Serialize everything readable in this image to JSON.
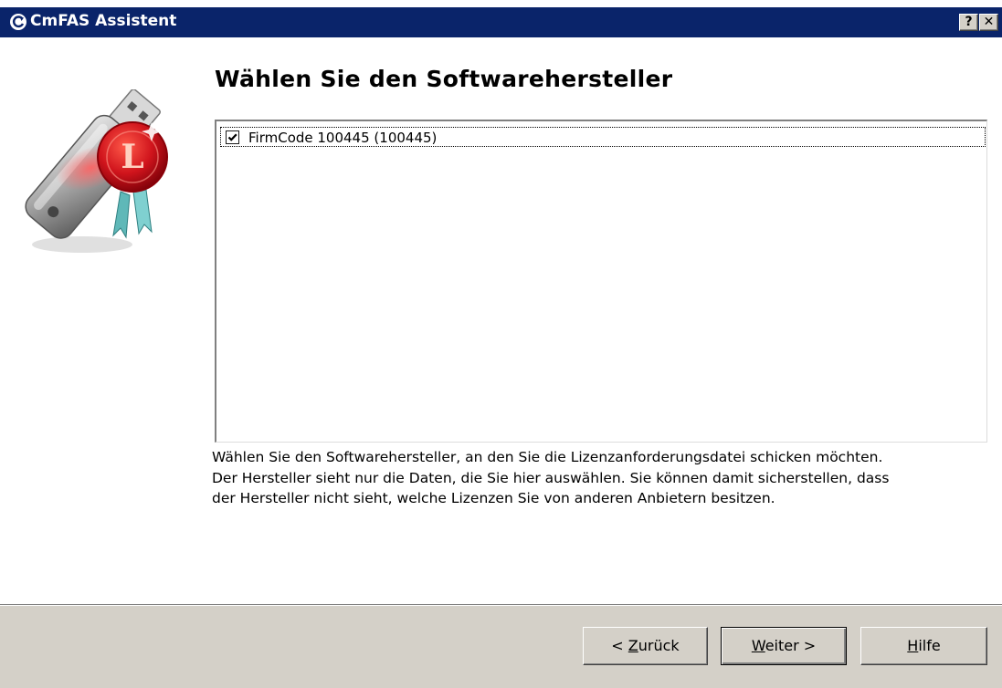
{
  "window": {
    "title": "CmFAS Assistent",
    "help_button": "?",
    "close_button": "✕"
  },
  "page": {
    "heading": "Wählen Sie den Softwarehersteller"
  },
  "vendor_list": {
    "items": [
      {
        "label": "FirmCode 100445 (100445)",
        "checked": true
      }
    ]
  },
  "description": {
    "line1": "Wählen Sie den Softwarehersteller, an den Sie die Lizenzanforderungsdatei schicken möchten.",
    "line2": "Der Hersteller sieht nur die Daten, die Sie hier auswählen. Sie können damit sicherstellen, dass",
    "line3": "der Hersteller nicht sieht, welche Lizenzen Sie von anderen Anbietern besitzen."
  },
  "buttons": {
    "back": {
      "prefix": "< ",
      "accel": "Z",
      "rest": "urück"
    },
    "next": {
      "accel": "W",
      "rest": "eiter >"
    },
    "help": {
      "accel": "H",
      "rest": "ilfe"
    }
  },
  "colors": {
    "titlebar": "#0a246a",
    "face": "#d4d0c8",
    "seal_red": "#c8101a"
  },
  "icons": {
    "app": "cmfas-refresh-icon",
    "hero": "usb-dongle-license-seal-icon",
    "checkbox": "checkmark-icon"
  }
}
